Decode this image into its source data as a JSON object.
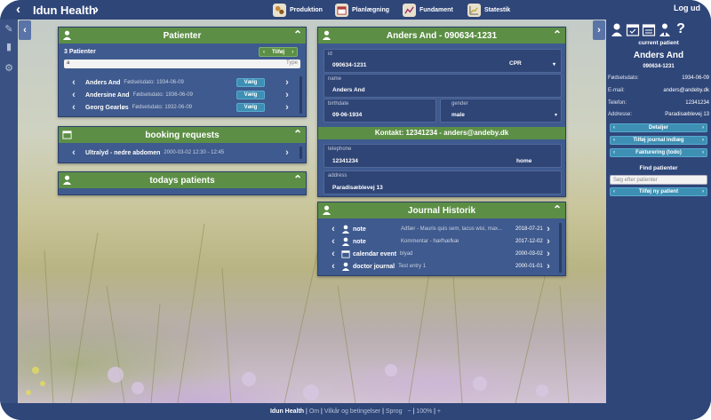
{
  "app": {
    "title": "Idun Health",
    "logout_label": "Log ud"
  },
  "nav": [
    {
      "label": "Produktion",
      "icon": "gears-icon",
      "color": "#c98a3a"
    },
    {
      "label": "Planlægning",
      "icon": "calendar-icon",
      "color": "#b23a3a"
    },
    {
      "label": "Fundament",
      "icon": "trend-line-icon",
      "color": "#9a2a6a"
    },
    {
      "label": "Statestik",
      "icon": "chart-icon",
      "color": "#c2a83a"
    }
  ],
  "patients_panel": {
    "title": "Patienter",
    "count_text": "3 Patienter",
    "add_label": "Tilføj",
    "filter_value": "a",
    "type_placeholder": "Type",
    "dob_label": "Fødselsdato:",
    "select_label": "Vælg",
    "rows": [
      {
        "name": "Anders And",
        "dob": "1934-06-09"
      },
      {
        "name": "Andersine And",
        "dob": "1936-06-09"
      },
      {
        "name": "Georg Gearløs",
        "dob": "1932-06-09"
      }
    ]
  },
  "booking_panel": {
    "title": "booking requests",
    "rows": [
      {
        "name": "Ultralyd - nedre abdomen",
        "time": "2000-03-02 12:30 - 12:45"
      }
    ]
  },
  "todays_panel": {
    "title": "todays patients"
  },
  "patient_detail": {
    "title": "Anders And - 090634-1231",
    "id_label": "id",
    "id_value": "090634-1231",
    "id_type": "CPR",
    "name_label": "name",
    "name_value": "Anders And",
    "birthdate_label": "birthdate",
    "birthdate_value": "09-06-1934",
    "gender_label": "gender",
    "gender_value": "male",
    "contact_title": "Kontakt: 12341234 - anders@andeby.dk",
    "telephone_label": "telephone",
    "telephone_value": "12341234",
    "telephone_type": "home",
    "address_label": "address",
    "address_value": "Paradisæblevej 13"
  },
  "journal": {
    "title": "Journal Historik",
    "rows": [
      {
        "type": "note",
        "text": "Adfær - Mauris quis sem, lacus wisi, max...",
        "date": "2018-07-21",
        "icon": "person-icon"
      },
      {
        "type": "note",
        "text": "Kommentar - hæfhæfkæ",
        "date": "2017-12-02",
        "icon": "person-icon"
      },
      {
        "type": "calendar event",
        "text": "blyad",
        "date": "2000-03-02",
        "icon": "calendar-icon"
      },
      {
        "type": "doctor journal",
        "text": "Test entry 1",
        "date": "2000-01-01",
        "icon": "person-icon"
      }
    ]
  },
  "current_patient": {
    "header": "current patient",
    "name": "Anders And",
    "cpr": "090634-1231",
    "fields": [
      {
        "key": "Fødselsdato:",
        "value": "1934-06-09"
      },
      {
        "key": "E-mail:",
        "value": "anders@andeby.dk"
      },
      {
        "key": "Telefon:",
        "value": "12341234"
      },
      {
        "key": "Addresse:",
        "value": "Paradisæblevej 13"
      }
    ],
    "buttons": [
      "Detaljer",
      "Tilføj journal indlæg",
      "Fakturering (todo)"
    ],
    "find_header": "Find patienter",
    "search_placeholder": "Søg efter patienter",
    "add_patient_label": "Tilføj ny patient"
  },
  "footer": {
    "brand": "Idun Health",
    "links": [
      "Om",
      "Vilkår og betingelser",
      "Sprog",
      "100%"
    ],
    "minus": "−",
    "plus": "+"
  }
}
